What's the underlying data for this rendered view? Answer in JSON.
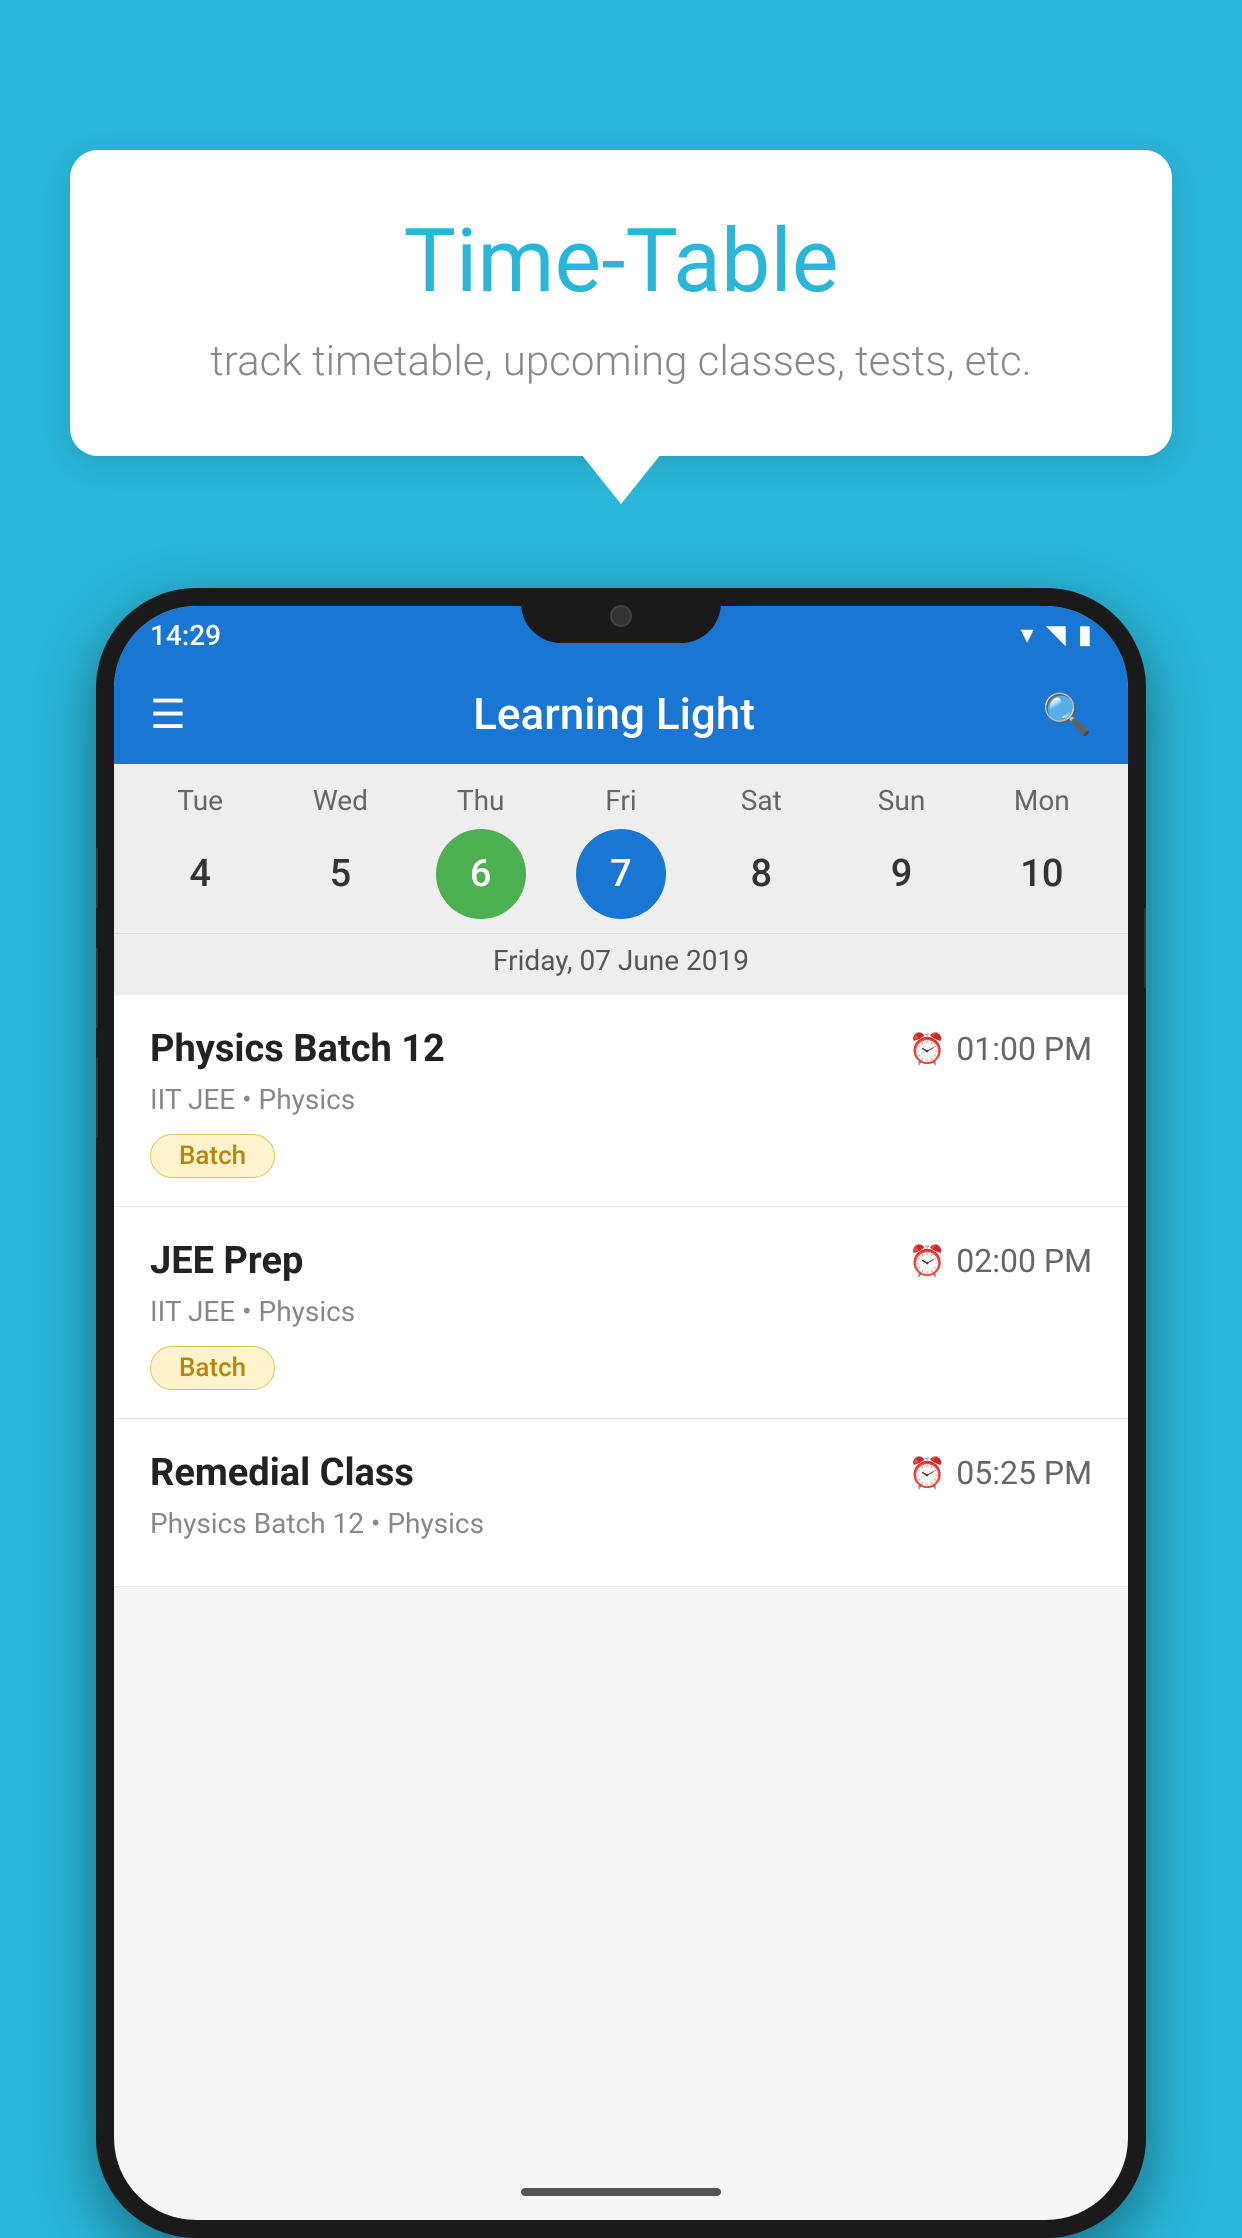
{
  "background": {
    "color": "#29b6d8"
  },
  "tooltip": {
    "title": "Time-Table",
    "subtitle": "track timetable, upcoming classes, tests, etc."
  },
  "phone": {
    "status_bar": {
      "time": "14:29"
    },
    "toolbar": {
      "title": "Learning Light"
    },
    "calendar": {
      "days": [
        "Tue",
        "Wed",
        "Thu",
        "Fri",
        "Sat",
        "Sun",
        "Mon"
      ],
      "dates": [
        "4",
        "5",
        "6",
        "7",
        "8",
        "9",
        "10"
      ],
      "today_index": 2,
      "selected_index": 3,
      "selected_date_label": "Friday, 07 June 2019"
    },
    "schedule": [
      {
        "title": "Physics Batch 12",
        "time": "01:00 PM",
        "subtitle": "IIT JEE • Physics",
        "badge": "Batch"
      },
      {
        "title": "JEE Prep",
        "time": "02:00 PM",
        "subtitle": "IIT JEE • Physics",
        "badge": "Batch"
      },
      {
        "title": "Remedial Class",
        "time": "05:25 PM",
        "subtitle": "Physics Batch 12 • Physics",
        "badge": ""
      }
    ]
  }
}
